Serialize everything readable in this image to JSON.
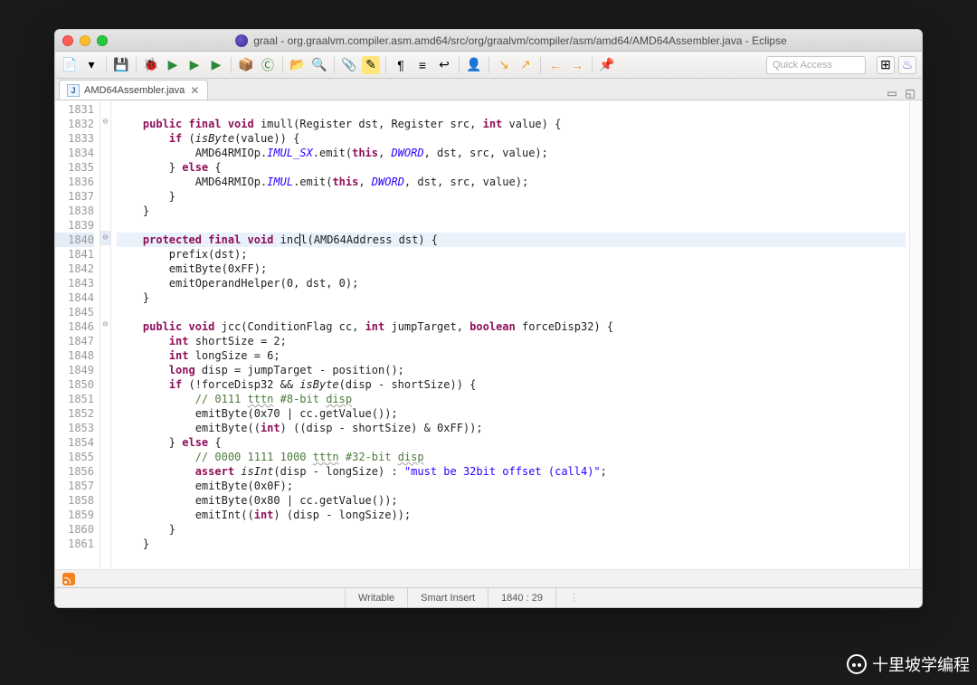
{
  "window": {
    "title": "graal - org.graalvm.compiler.asm.amd64/src/org/graalvm/compiler/asm/amd64/AMD64Assembler.java - Eclipse"
  },
  "toolbar": {
    "quick_access_placeholder": "Quick Access"
  },
  "tab": {
    "label": "AMD64Assembler.java",
    "jchar": "J"
  },
  "gutter": {
    "start": 1831,
    "end": 1861
  },
  "code": {
    "lines": [
      {
        "n": 1831,
        "t": "",
        "hl": false,
        "fold": ""
      },
      {
        "n": 1832,
        "t": "    <kw>public final void</kw> imull(Register dst, Register src, <kw>int</kw> value) {",
        "hl": false,
        "fold": "⊖"
      },
      {
        "n": 1833,
        "t": "        <kw>if</kw> (<it>isByte</it>(value)) {",
        "hl": false,
        "fold": ""
      },
      {
        "n": 1834,
        "t": "            AMD64RMIOp.<fld>IMUL_SX</fld>.emit(<kw>this</kw>, <fld>DWORD</fld>, dst, src, value);",
        "hl": false,
        "fold": ""
      },
      {
        "n": 1835,
        "t": "        } <kw>else</kw> {",
        "hl": false,
        "fold": ""
      },
      {
        "n": 1836,
        "t": "            AMD64RMIOp.<fld>IMUL</fld>.emit(<kw>this</kw>, <fld>DWORD</fld>, dst, src, value);",
        "hl": false,
        "fold": ""
      },
      {
        "n": 1837,
        "t": "        }",
        "hl": false,
        "fold": ""
      },
      {
        "n": 1838,
        "t": "    }",
        "hl": false,
        "fold": ""
      },
      {
        "n": 1839,
        "t": "",
        "hl": false,
        "fold": ""
      },
      {
        "n": 1840,
        "t": "    <kw>protected final void</kw> inc<cursor></cursor>l(AMD64Address dst) {",
        "hl": true,
        "fold": "⊖"
      },
      {
        "n": 1841,
        "t": "        prefix(dst);",
        "hl": false,
        "fold": ""
      },
      {
        "n": 1842,
        "t": "        emitByte(0xFF);",
        "hl": false,
        "fold": ""
      },
      {
        "n": 1843,
        "t": "        emitOperandHelper(0, dst, 0);",
        "hl": false,
        "fold": ""
      },
      {
        "n": 1844,
        "t": "    }",
        "hl": false,
        "fold": ""
      },
      {
        "n": 1845,
        "t": "",
        "hl": false,
        "fold": ""
      },
      {
        "n": 1846,
        "t": "    <kw>public void</kw> jcc(ConditionFlag cc, <kw>int</kw> jumpTarget, <kw>boolean</kw> forceDisp32) {",
        "hl": false,
        "fold": "⊖"
      },
      {
        "n": 1847,
        "t": "        <kw>int</kw> shortSize = 2;",
        "hl": false,
        "fold": ""
      },
      {
        "n": 1848,
        "t": "        <kw>int</kw> longSize = 6;",
        "hl": false,
        "fold": ""
      },
      {
        "n": 1849,
        "t": "        <kw>long</kw> disp = jumpTarget - position();",
        "hl": false,
        "fold": ""
      },
      {
        "n": 1850,
        "t": "        <kw>if</kw> (!forceDisp32 && <it>isByte</it>(disp - shortSize)) {",
        "hl": false,
        "fold": ""
      },
      {
        "n": 1851,
        "t": "            <cmt>// 0111 <u>tttn</u> #8-bit <u>disp</u></cmt>",
        "hl": false,
        "fold": ""
      },
      {
        "n": 1852,
        "t": "            emitByte(0x70 | cc.getValue());",
        "hl": false,
        "fold": ""
      },
      {
        "n": 1853,
        "t": "            emitByte((<kw>int</kw>) ((disp - shortSize) & 0xFF));",
        "hl": false,
        "fold": ""
      },
      {
        "n": 1854,
        "t": "        } <kw>else</kw> {",
        "hl": false,
        "fold": ""
      },
      {
        "n": 1855,
        "t": "            <cmt>// 0000 1111 1000 <u>tttn</u> #32-bit <u>disp</u></cmt>",
        "hl": false,
        "fold": ""
      },
      {
        "n": 1856,
        "t": "            <kw>assert</kw> <it>isInt</it>(disp - longSize) : <str>\"must be 32bit offset (call4)\"</str>;",
        "hl": false,
        "fold": ""
      },
      {
        "n": 1857,
        "t": "            emitByte(0x0F);",
        "hl": false,
        "fold": ""
      },
      {
        "n": 1858,
        "t": "            emitByte(0x80 | cc.getValue());",
        "hl": false,
        "fold": ""
      },
      {
        "n": 1859,
        "t": "            emitInt((<kw>int</kw>) (disp - longSize));",
        "hl": false,
        "fold": ""
      },
      {
        "n": 1860,
        "t": "        }",
        "hl": false,
        "fold": ""
      },
      {
        "n": 1861,
        "t": "    }",
        "hl": false,
        "fold": ""
      }
    ]
  },
  "status": {
    "writable": "Writable",
    "insert": "Smart Insert",
    "position": "1840 : 29"
  },
  "watermark": "十里坡学编程"
}
